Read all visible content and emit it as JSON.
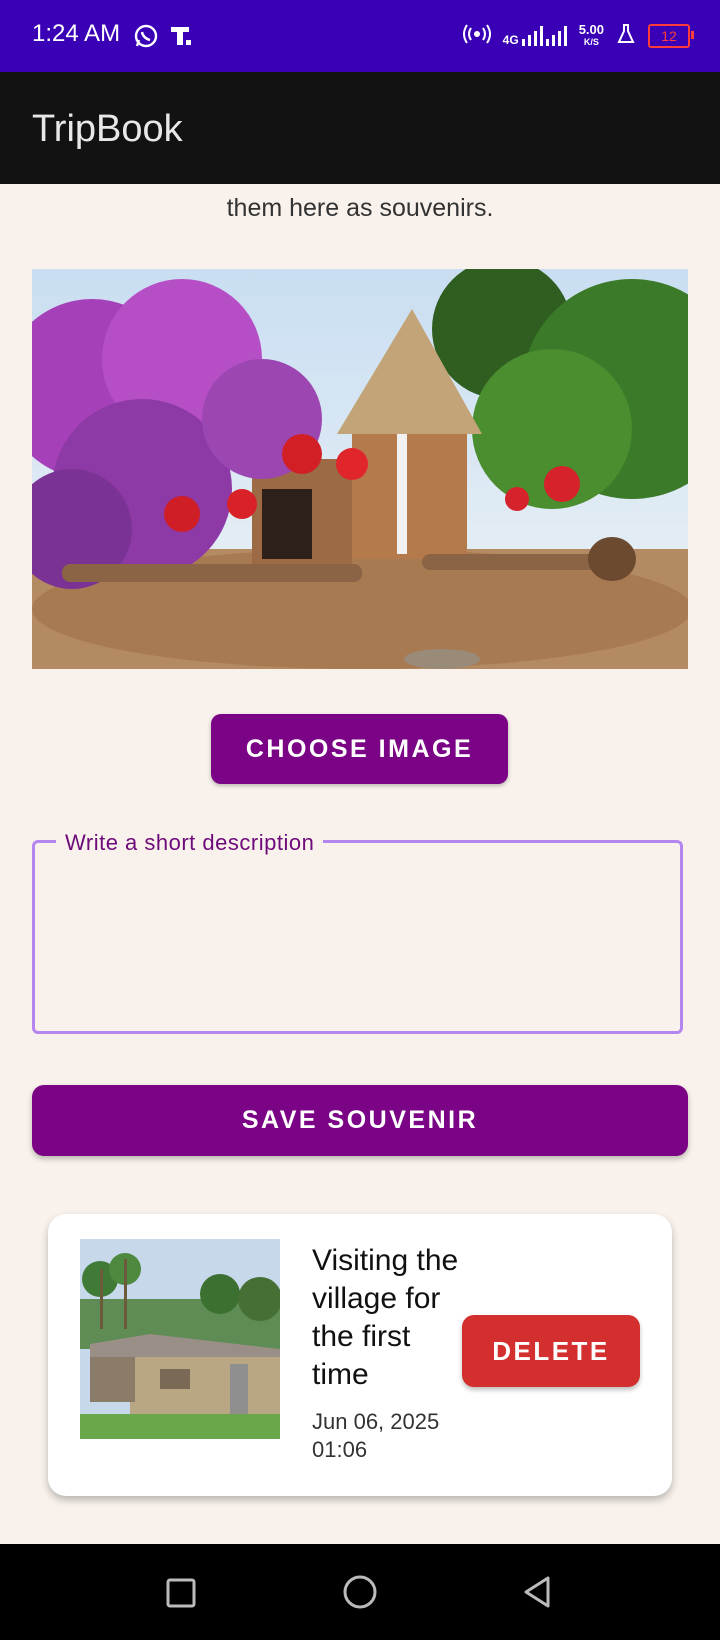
{
  "status": {
    "time": "1:24 AM",
    "net_label": "4G",
    "speed": "5.00",
    "speed_unit": "K/S",
    "battery": "12"
  },
  "app": {
    "title": "TripBook"
  },
  "intro": {
    "text": "them here as souvenirs."
  },
  "buttons": {
    "choose_image": "CHOOSE IMAGE",
    "save": "SAVE SOUVENIR"
  },
  "description": {
    "label": "Write a short description",
    "value": ""
  },
  "souvenirs": [
    {
      "title": "Visiting the village for the first time",
      "date": "Jun 06, 2025 01:06",
      "delete_label": "DELETE"
    }
  ],
  "colors": {
    "status_bar": "#3a00b6",
    "app_bar": "#121212",
    "primary": "#7b0486",
    "delete": "#d32f2f",
    "outline": "#b585f0",
    "background": "#f9f2ec"
  },
  "icons": [
    "whatsapp-icon",
    "t-app-icon",
    "hotspot-icon",
    "signal-icon",
    "lab-icon",
    "battery-icon",
    "recents-icon",
    "home-icon",
    "back-icon"
  ]
}
